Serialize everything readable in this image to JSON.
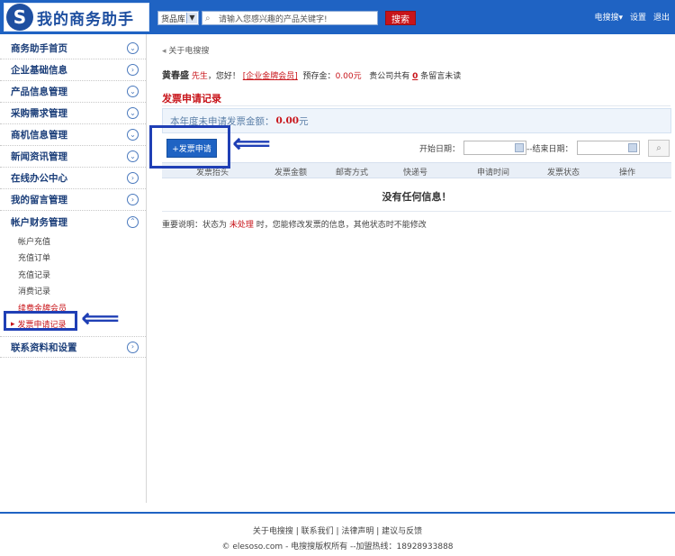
{
  "header": {
    "logo_text": "我的商务助手",
    "search_type": "货品库",
    "search_placeholder": "请输入您感兴趣的产品关键字!",
    "search_button": "搜索",
    "links": [
      "电搜搜▾",
      "设置",
      "退出"
    ]
  },
  "sidebar": {
    "items": [
      {
        "label": "商务助手首页"
      },
      {
        "label": "企业基础信息"
      },
      {
        "label": "产品信息管理"
      },
      {
        "label": "采购需求管理"
      },
      {
        "label": "商机信息管理"
      },
      {
        "label": "新闻资讯管理"
      },
      {
        "label": "在线办公中心"
      },
      {
        "label": "我的留言管理"
      },
      {
        "label": "帐户财务管理"
      }
    ],
    "sub_items": [
      "帐户充值",
      "充值订单",
      "充值记录",
      "消费记录",
      "续费金牌会员",
      "发票申请记录"
    ],
    "last_item": "联系资料和设置"
  },
  "main": {
    "breadcrumb": "关于电搜搜",
    "user_name": "黄春盛",
    "user_title": "先生",
    "greeting": "，您好！",
    "member_level": "[企业金牌会员]",
    "prepay_label": "预存金：",
    "prepay_amount": "0.00元",
    "msg_prefix": "贵公司共有",
    "msg_count": "0",
    "msg_suffix": "条留言未读",
    "section_title": "发票申请记录",
    "info_text": "本年度未申请发票金额：",
    "info_amount": "0.00",
    "info_unit": "元",
    "new_button": "+发票申请",
    "start_date_label": "开始日期：",
    "end_date_label": "--结束日期：",
    "columns": [
      "发票抬头",
      "发票金额",
      "邮寄方式",
      "快递号",
      "申请时间",
      "发票状态",
      "操作"
    ],
    "empty_text": "没有任何信息！",
    "note_prefix": "重要说明：状态为",
    "note_status": "未处理",
    "note_suffix": "时，您能修改发票的信息，其他状态时不能修改"
  },
  "footer": {
    "links": "关于电搜搜 | 联系我们 | 法律声明 | 建议与反馈",
    "copyright": "© elesoso.com - 电搜搜版权所有 --加盟热线：18928933888"
  }
}
